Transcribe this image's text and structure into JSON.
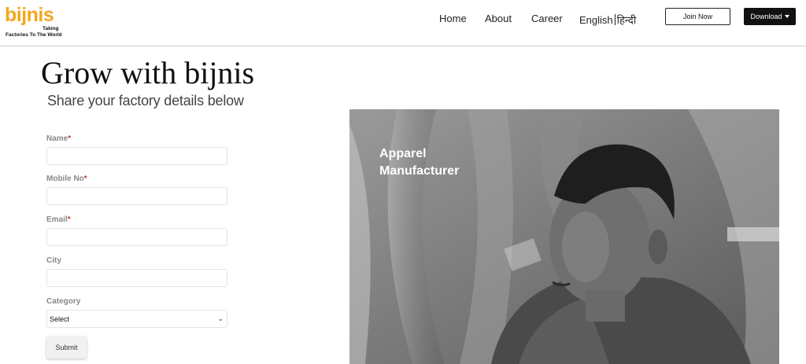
{
  "header": {
    "logo": {
      "word": "bijnis",
      "taking": "Taking",
      "tagline": "Factories To The World"
    },
    "nav": [
      {
        "label": "Home"
      },
      {
        "label": "About"
      },
      {
        "label": "Career"
      }
    ],
    "language": {
      "english": "English",
      "hindi": "हिन्दी"
    },
    "join_label": "Join Now",
    "download_label": "Download"
  },
  "hero": {
    "title": "Grow with bijnis",
    "subtitle": "Share your factory details below"
  },
  "form": {
    "name_label": "Name",
    "mobile_label": "Mobile No",
    "email_label": "Email",
    "city_label": "City",
    "category_label": "Category",
    "category_value": "Select",
    "required_mark": "*",
    "submit_label": "Submit"
  },
  "photo": {
    "caption_line1": "Apparel",
    "caption_line2": "Manufacturer"
  }
}
